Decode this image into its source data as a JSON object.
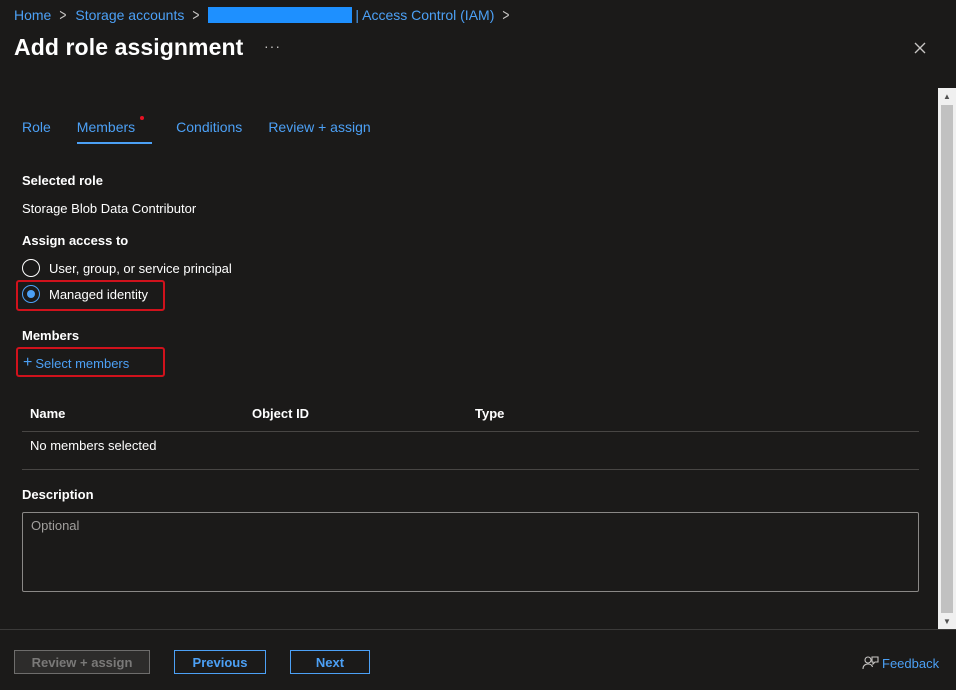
{
  "breadcrumb": {
    "items": [
      "Home",
      "Storage accounts",
      "| Access Control (IAM)"
    ]
  },
  "page": {
    "title": "Add role assignment",
    "more": "···"
  },
  "tabs": [
    "Role",
    "Members",
    "Conditions",
    "Review + assign"
  ],
  "selected_role": {
    "label": "Selected role",
    "value": "Storage Blob Data Contributor"
  },
  "assign_access": {
    "label": "Assign access to",
    "options": [
      "User, group, or service principal",
      "Managed identity"
    ],
    "selected": "Managed identity"
  },
  "members": {
    "label": "Members",
    "select_link": "Select members",
    "columns": [
      "Name",
      "Object ID",
      "Type"
    ],
    "empty_text": "No members selected"
  },
  "description": {
    "label": "Description",
    "placeholder": "Optional"
  },
  "footer": {
    "review_assign": "Review + assign",
    "previous": "Previous",
    "next": "Next",
    "feedback": "Feedback"
  },
  "colors": {
    "accent": "#4ca0f5",
    "highlight": "#d0121c",
    "background": "#1b1a19"
  }
}
